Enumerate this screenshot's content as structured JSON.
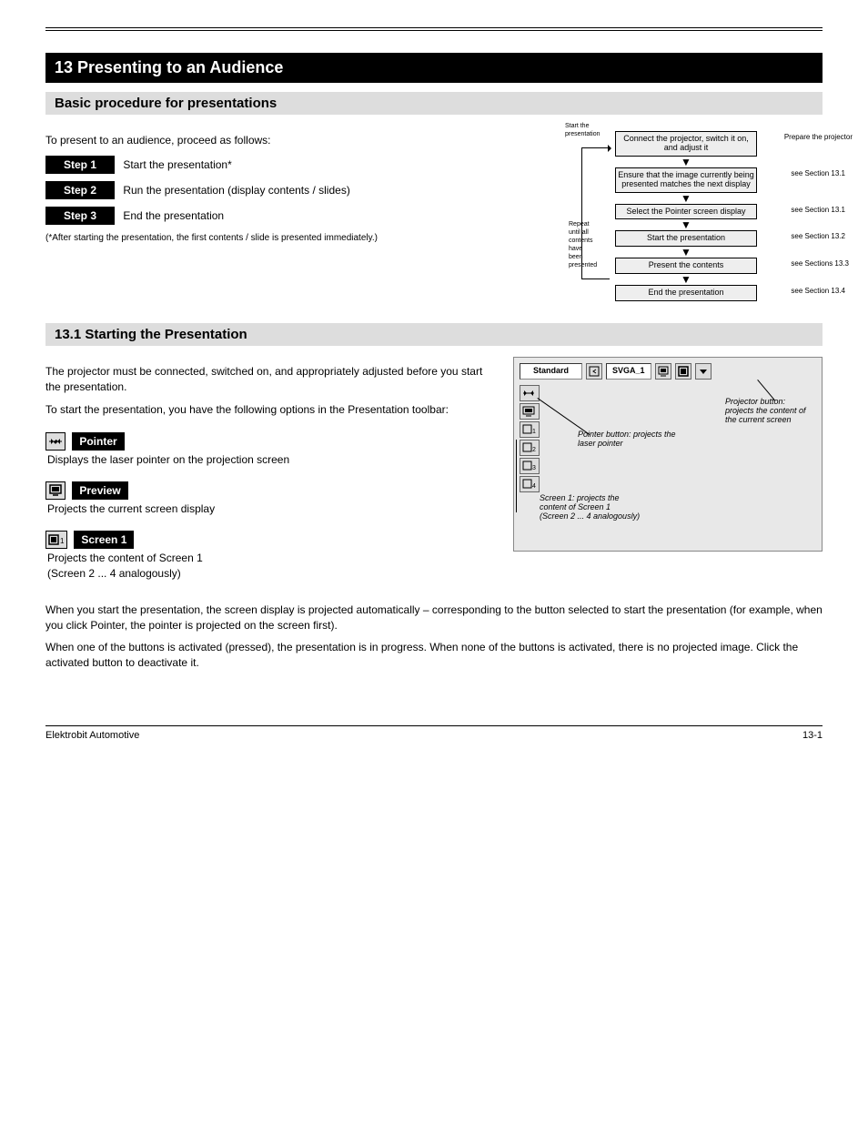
{
  "header": {
    "title": "13 Presenting to an Audience",
    "subtitle1": "Basic procedure for presentations"
  },
  "intro": "To present to an audience, proceed as follows:",
  "steps": [
    {
      "label": "Step 1",
      "text": "Start the presentation*"
    },
    {
      "label": "Step 2",
      "text": "Run the presentation (display contents / slides)"
    },
    {
      "label": "Step 3",
      "text": "End the presentation"
    }
  ],
  "footnote": "(*After starting the presentation, the first contents / slide is presented immediately.)",
  "flow": {
    "tiny": "Start the\npresentation",
    "boxes": [
      "Connect the projector, switch it on, and adjust it",
      "Ensure that the image currently being presented matches the next display",
      "Select the Pointer screen display",
      "Start the presentation",
      "Present the contents",
      "End the presentation"
    ],
    "loop_caption": "Repeat until all contents have\nbeen presented",
    "right_labels": [
      "Prepare the projector",
      "see Section 13.1",
      "see Section 13.1",
      "see Section 13.2",
      "see Sections 13.3",
      "see Section 13.4"
    ]
  },
  "subtitle2": "13.1 Starting the Presentation",
  "sec2_intro": "The projector must be connected, switched on, and appropriately adjusted before you start the presentation.",
  "sec2_line2": "To start the presentation, you have the following options in the Presentation toolbar:",
  "buttons": [
    {
      "name": "pointer",
      "label": "Pointer",
      "desc": "Displays the laser pointer on the projection screen"
    },
    {
      "name": "preview",
      "label": "Preview",
      "desc": "Projects the current screen display"
    },
    {
      "name": "screen-1",
      "label": "Screen 1",
      "desc": "Projects the content of Screen 1\n(Screen 2 ... 4 analogously)"
    }
  ],
  "toolbar": {
    "field": "Standard",
    "svga": "SVGA_1",
    "side_nums": [
      "1",
      "2",
      "3",
      "4"
    ]
  },
  "annotations": {
    "a1": "Projector button:\nprojects the content of\nthe current screen",
    "a2": "Pointer button: projects the\nlaser pointer",
    "a3": "Screen 1: projects the\ncontent of Screen 1\n(Screen 2 ... 4 analogously)"
  },
  "sec2_para1": "When you start the presentation, the screen display is projected automatically – corresponding to the button selected to start the presentation (for example, when you click Pointer, the pointer is projected on the screen first).",
  "sec2_para2": "When one of the buttons is activated (pressed), the presentation is in progress. When none of the buttons is activated, there is no projected image. Click the activated button to deactivate it.",
  "footer": {
    "left": "Elektrobit Automotive",
    "right": "13-1"
  }
}
